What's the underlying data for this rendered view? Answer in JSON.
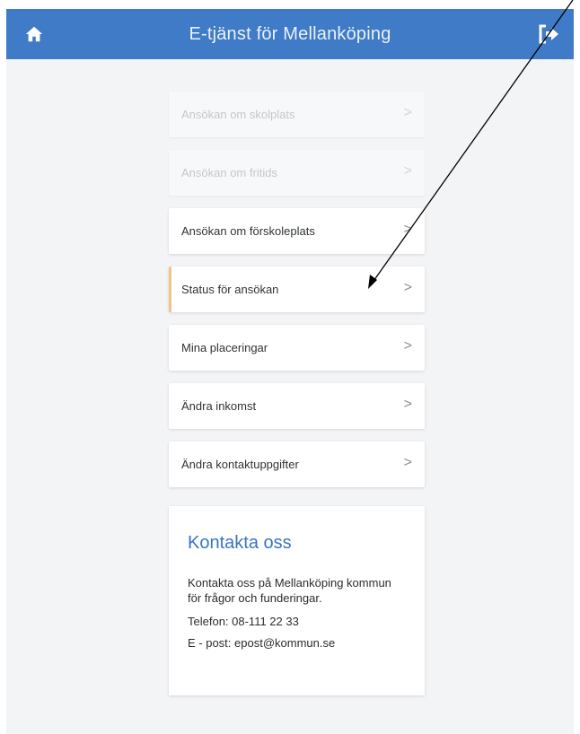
{
  "header": {
    "title": "E-tjänst för Mellanköping",
    "home_icon": "home-icon",
    "logout_icon": "logout-icon",
    "bar_color": "#3f7bc6"
  },
  "menu": {
    "items": [
      {
        "label": "Ansökan om skolplats",
        "state": "disabled"
      },
      {
        "label": "Ansökan om fritids",
        "state": "disabled"
      },
      {
        "label": "Ansökan om förskoleplats",
        "state": "normal"
      },
      {
        "label": "Status för ansökan",
        "state": "active"
      },
      {
        "label": "Mina placeringar",
        "state": "normal"
      },
      {
        "label": "Ändra inkomst",
        "state": "normal"
      },
      {
        "label": "Ändra kontaktuppgifter",
        "state": "normal"
      }
    ],
    "chevron": ">",
    "active_accent": "#f1c58a"
  },
  "contact": {
    "heading": "Kontakta oss",
    "text": "Kontakta oss på Mellanköping kommun för frågor och funderingar.",
    "phone": "Telefon: 08-111 22 33",
    "email": "E - post: epost@kommun.se"
  }
}
